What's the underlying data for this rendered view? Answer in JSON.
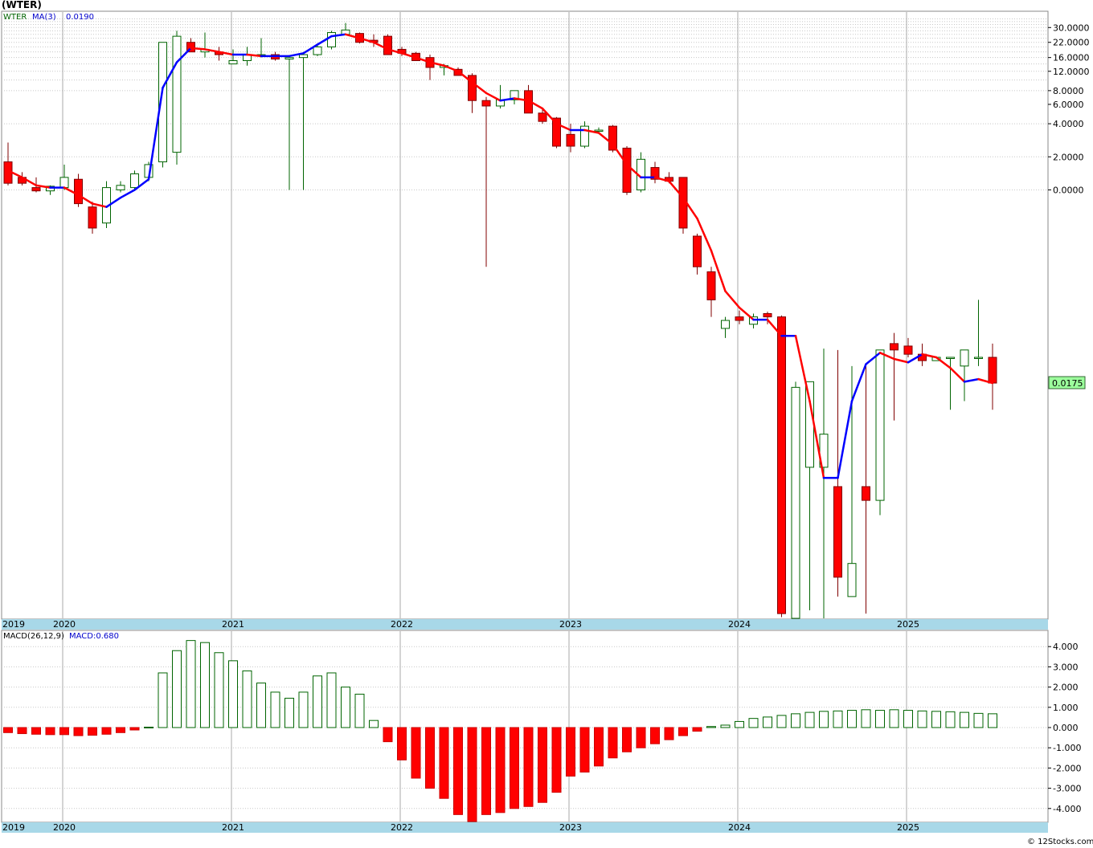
{
  "page": {
    "title": "(WTER)",
    "watermark": "© 12Stocks.com"
  },
  "chart_data": [
    {
      "type": "candlestick",
      "scale": "log",
      "legend": {
        "symbol": "WTER",
        "ma_label": "MA(3)",
        "ma_value": "0.0190"
      },
      "last_price_label": "0.0175",
      "y_tick_labels": [
        "30.0000",
        "22.0000",
        "16.0000",
        "12.0000",
        "8.0000",
        "6.0000",
        "4.0000",
        "2.0000",
        "0.0000"
      ],
      "y_tick_values": [
        30,
        22,
        16,
        12,
        8,
        6,
        4,
        2,
        1
      ],
      "x_tick_labels": [
        "2019",
        "2020",
        "2021",
        "2022",
        "2023",
        "2024",
        "2025"
      ],
      "colors": {
        "up": "#006400",
        "down": "#ff0000",
        "ma_up": "#0000ff",
        "ma_down": "#ff0000"
      },
      "months": [
        "2019-11",
        "2019-12",
        "2020-01",
        "2020-02",
        "2020-03",
        "2020-04",
        "2020-05",
        "2020-06",
        "2020-07",
        "2020-08",
        "2020-09",
        "2020-10",
        "2020-11",
        "2020-12",
        "2021-01",
        "2021-02",
        "2021-03",
        "2021-04",
        "2021-05",
        "2021-06",
        "2021-07",
        "2021-08",
        "2021-09",
        "2021-10",
        "2021-11",
        "2021-12",
        "2022-01",
        "2022-02",
        "2022-03",
        "2022-04",
        "2022-05",
        "2022-06",
        "2022-07",
        "2022-08",
        "2022-09",
        "2022-10",
        "2022-11",
        "2022-12",
        "2023-01",
        "2023-02",
        "2023-03",
        "2023-04",
        "2023-05",
        "2023-06",
        "2023-07",
        "2023-08",
        "2023-09",
        "2023-10",
        "2023-11",
        "2023-12",
        "2024-01",
        "2024-02",
        "2024-03",
        "2024-04",
        "2024-05",
        "2024-06",
        "2024-07",
        "2024-08",
        "2024-09",
        "2024-10",
        "2024-11",
        "2024-12",
        "2025-01",
        "2025-02",
        "2025-03",
        "2025-04",
        "2025-05",
        "2025-06",
        "2025-07",
        "2025-08",
        "2025-09"
      ],
      "candles": [
        [
          1.8,
          2.7,
          1.1,
          1.15
        ],
        [
          1.3,
          1.45,
          1.1,
          1.15
        ],
        [
          1.05,
          1.3,
          0.95,
          0.98
        ],
        [
          0.98,
          1.1,
          0.9,
          1.08
        ],
        [
          1.05,
          1.7,
          1.0,
          1.3
        ],
        [
          1.25,
          1.4,
          0.7,
          0.75
        ],
        [
          0.7,
          0.78,
          0.4,
          0.45
        ],
        [
          0.5,
          1.2,
          0.45,
          1.05
        ],
        [
          1.0,
          1.2,
          0.95,
          1.1
        ],
        [
          1.05,
          1.5,
          1.0,
          1.4
        ],
        [
          1.3,
          1.8,
          1.2,
          1.7
        ],
        [
          1.8,
          2.7,
          1.6,
          22.0
        ],
        [
          2.2,
          28.0,
          1.7,
          25.0
        ],
        [
          22.0,
          24.0,
          18.0,
          18.0
        ],
        [
          18.0,
          27.0,
          16.0,
          19.0
        ],
        [
          18.0,
          20.0,
          15.0,
          17.0
        ],
        [
          14.0,
          19.0,
          14.0,
          15.0
        ],
        [
          15.0,
          20.0,
          13.5,
          17.0
        ],
        [
          17.0,
          24.0,
          16.0,
          17.0
        ],
        [
          17.0,
          18.0,
          15.0,
          15.5
        ],
        [
          15.5,
          16.5,
          1.0,
          16.0
        ],
        [
          16.0,
          17.0,
          1.0,
          17.0
        ],
        [
          17.0,
          21.0,
          16.5,
          20.0
        ],
        [
          20.0,
          28.0,
          19.0,
          27.0
        ],
        [
          26.0,
          33.0,
          25.5,
          28.5
        ],
        [
          26.5,
          27.0,
          21.5,
          22.0
        ],
        [
          23.0,
          26.0,
          20.0,
          22.0
        ],
        [
          25.0,
          26.0,
          17.0,
          17.0
        ],
        [
          19.0,
          20.0,
          16.5,
          17.5
        ],
        [
          17.5,
          18.0,
          15.0,
          15.0
        ],
        [
          16.0,
          17.0,
          10.0,
          13.0
        ],
        [
          13.0,
          14.0,
          11.0,
          13.5
        ],
        [
          12.5,
          13.0,
          11.0,
          11.0
        ],
        [
          11.0,
          11.5,
          5.0,
          6.5
        ],
        [
          6.5,
          7.0,
          0.2,
          5.8
        ],
        [
          5.8,
          9.0,
          5.5,
          6.6
        ],
        [
          6.6,
          8.0,
          6.0,
          8.0
        ],
        [
          8.0,
          9.0,
          5.0,
          5.0
        ],
        [
          5.0,
          5.5,
          4.0,
          4.2
        ],
        [
          4.5,
          4.6,
          2.4,
          2.5
        ],
        [
          3.2,
          4.0,
          2.2,
          2.5
        ],
        [
          2.5,
          4.2,
          2.4,
          3.8
        ],
        [
          3.5,
          3.7,
          3.5,
          3.5
        ],
        [
          3.8,
          3.9,
          2.2,
          2.3
        ],
        [
          2.4,
          2.5,
          0.9,
          0.95
        ],
        [
          1.0,
          2.2,
          0.95,
          1.9
        ],
        [
          1.6,
          1.8,
          1.15,
          1.25
        ],
        [
          1.3,
          1.45,
          1.15,
          1.2
        ],
        [
          1.3,
          1.3,
          0.4,
          0.45
        ],
        [
          0.38,
          0.4,
          0.17,
          0.2
        ],
        [
          0.18,
          0.2,
          0.07,
          0.1
        ],
        [
          0.055,
          0.07,
          0.045,
          0.065
        ],
        [
          0.07,
          0.08,
          0.06,
          0.065
        ],
        [
          0.06,
          0.075,
          0.055,
          0.07
        ],
        [
          0.075,
          0.078,
          0.06,
          0.07
        ],
        [
          0.07,
          0.072,
          0.00013,
          0.00014
        ],
        [
          0.00012,
          0.018,
          0.00011,
          0.016
        ],
        [
          0.003,
          0.016,
          0.00015,
          0.018
        ],
        [
          0.003,
          0.036,
          0.0001,
          0.006
        ],
        [
          0.002,
          0.035,
          0.0002,
          0.0003
        ],
        [
          0.0002,
          0.025,
          0.0002,
          0.0004
        ],
        [
          0.002,
          0.025,
          0.00014,
          0.0015
        ],
        [
          0.0015,
          0.025,
          0.0011,
          0.035
        ],
        [
          0.04,
          0.05,
          0.008,
          0.035
        ],
        [
          0.038,
          0.045,
          0.03,
          0.032
        ],
        [
          0.032,
          0.04,
          0.025,
          0.028
        ],
        [
          0.028,
          0.03,
          0.028,
          0.03
        ],
        [
          0.03,
          0.03,
          0.01,
          0.03
        ],
        [
          0.025,
          0.03,
          0.012,
          0.035
        ],
        [
          0.03,
          0.1,
          0.025,
          0.03
        ],
        [
          0.03,
          0.04,
          0.01,
          0.0175
        ]
      ],
      "ma3": [
        1.5,
        1.3,
        1.1,
        1.05,
        1.05,
        0.9,
        0.75,
        0.7,
        0.85,
        1.0,
        1.25,
        8.5,
        14.5,
        19.5,
        19.0,
        18.0,
        17.0,
        17.0,
        16.5,
        16.5,
        16.5,
        17.5,
        21.0,
        25.0,
        26.0,
        24.0,
        22.0,
        19.0,
        17.5,
        16.0,
        14.5,
        13.5,
        12.0,
        9.5,
        7.6,
        6.5,
        6.8,
        6.5,
        5.5,
        4.0,
        3.5,
        3.5,
        3.3,
        2.6,
        1.7,
        1.3,
        1.3,
        1.2,
        0.85,
        0.55,
        0.28,
        0.12,
        0.085,
        0.066,
        0.066,
        0.047,
        0.047,
        0.012,
        0.0024,
        0.0024,
        0.012,
        0.026,
        0.033,
        0.029,
        0.027,
        0.032,
        0.03,
        0.024,
        0.018,
        0.019,
        0.0175
      ]
    },
    {
      "type": "bar",
      "legend": {
        "name": "MACD(26,12,9)",
        "value_label": "MACD:0.680"
      },
      "y_tick_labels": [
        "4.000",
        "3.000",
        "2.000",
        "1.000",
        "0.000",
        "-1.000",
        "-2.000",
        "-3.000",
        "-4.000"
      ],
      "y_tick_values": [
        4,
        3,
        2,
        1,
        0,
        -1,
        -2,
        -3,
        -4
      ],
      "ylim": [
        -4.8,
        4.5
      ],
      "x_tick_labels": [
        "2019",
        "2020",
        "2021",
        "2022",
        "2023",
        "2024",
        "2025"
      ],
      "values": [
        -0.25,
        -0.3,
        -0.33,
        -0.35,
        -0.35,
        -0.4,
        -0.38,
        -0.33,
        -0.25,
        -0.12,
        0.02,
        2.7,
        3.8,
        4.3,
        4.2,
        3.7,
        3.3,
        2.8,
        2.2,
        1.75,
        1.45,
        1.75,
        2.55,
        2.7,
        2.0,
        1.65,
        0.35,
        -0.7,
        -1.6,
        -2.5,
        -3.0,
        -3.5,
        -4.3,
        -4.7,
        -4.3,
        -4.2,
        -4.0,
        -3.9,
        -3.7,
        -3.2,
        -2.4,
        -2.2,
        -1.9,
        -1.5,
        -1.2,
        -1.0,
        -0.8,
        -0.6,
        -0.4,
        -0.18,
        0.05,
        0.12,
        0.3,
        0.45,
        0.52,
        0.6,
        0.68,
        0.75,
        0.8,
        0.82,
        0.85,
        0.88,
        0.85,
        0.88,
        0.85,
        0.82,
        0.8,
        0.78,
        0.75,
        0.7,
        0.68
      ]
    }
  ]
}
